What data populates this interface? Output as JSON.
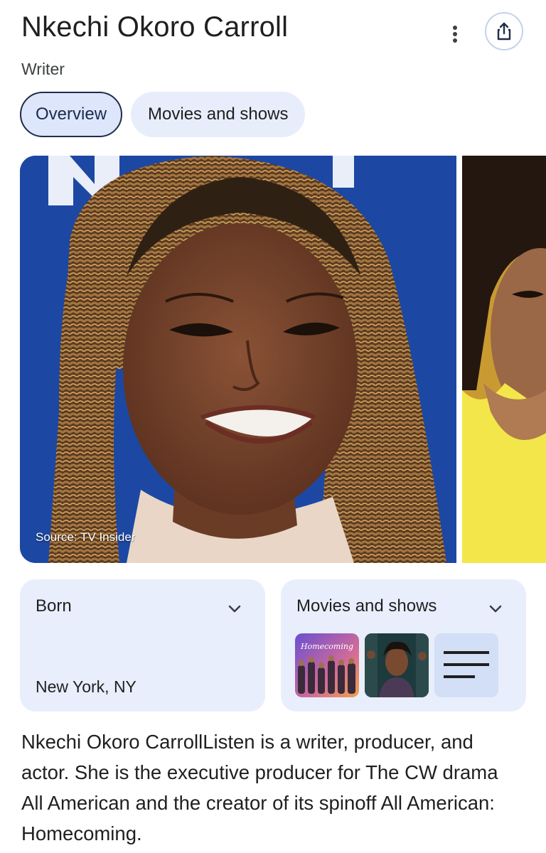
{
  "header": {
    "title": "Nkechi Okoro Carroll",
    "subtitle": "Writer"
  },
  "tabs": [
    {
      "label": "Overview",
      "active": true
    },
    {
      "label": "Movies and shows",
      "active": false
    }
  ],
  "photos": {
    "main_source": "Source: TV Insider"
  },
  "cards": {
    "born": {
      "label": "Born",
      "value": "New York, NY"
    },
    "movies": {
      "label": "Movies and shows",
      "thumbnail_text": "Homecoming"
    }
  },
  "description": "Nkechi Okoro CarrollListen is a writer, producer, and actor. She is the executive producer for The CW drama All American and the creator of its spinoff All American: Homecoming.",
  "icons": {
    "more": "more-vert-icon",
    "share": "share-icon",
    "expand": "chevron-down-icon",
    "list": "list-icon"
  },
  "colors": {
    "accent_chip": "#dde6fb",
    "card_bg": "#e8eefc",
    "share_border": "#c4d1ee"
  }
}
